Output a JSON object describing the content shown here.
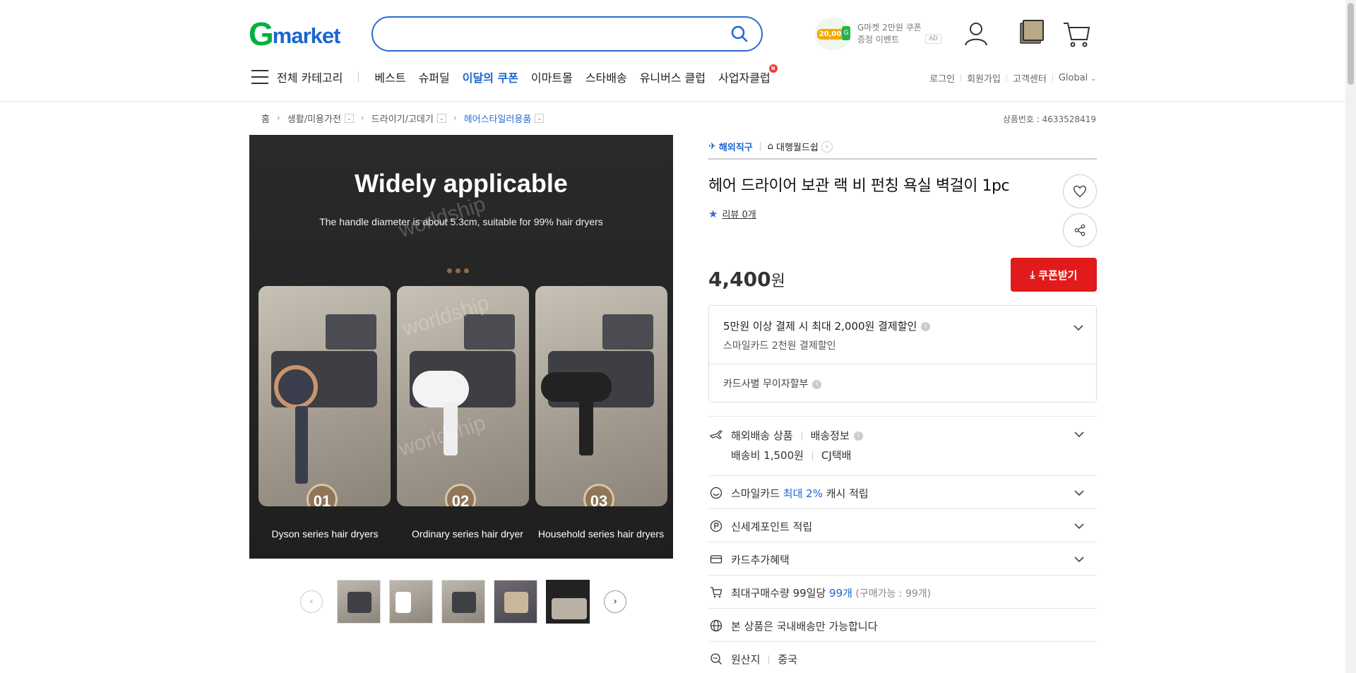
{
  "header": {
    "logo_g": "G",
    "logo_rest": "market",
    "search_placeholder": "",
    "ad": {
      "amount": "20,000",
      "g_mark": "G",
      "line1": "G마켓 2만원 쿠폰",
      "line2": "증정 이벤트",
      "tag": "AD"
    }
  },
  "gnb": {
    "all_category": "전체 카테고리",
    "items": [
      "베스트",
      "슈퍼딜",
      "이달의 쿠폰",
      "이마트몰",
      "스타배송",
      "유니버스 클럽",
      "사업자클럽"
    ],
    "new_badge": "N",
    "util": [
      "로그인",
      "회원가입",
      "고객센터",
      "Global"
    ]
  },
  "breadcrumb": {
    "items": [
      "홈",
      "생활/미용가전",
      "드라이기/고데기",
      "헤어스타일러용품"
    ],
    "product_no": "상품번호 : 4633528419"
  },
  "image": {
    "title": "Widely applicable",
    "subtitle": "The handle diameter is about 5.3cm, suitable for 99% hair dryers",
    "watermark": "worldship",
    "panels": [
      {
        "num": "01",
        "caption": "Dyson series hair dryers"
      },
      {
        "num": "02",
        "caption": "Ordinary series hair dryer"
      },
      {
        "num": "03",
        "caption": "Household series hair dryers"
      }
    ]
  },
  "product": {
    "overseas": "해외직구",
    "shop": "대행월드쉽",
    "title": "헤어 드라이어 보관 랙 비 펀칭 욕실 벽걸이 1pc",
    "review": "리뷰 0개",
    "price": "4,400",
    "won": "원",
    "coupon_button": "쿠폰받기",
    "discount": {
      "line1": "5만원 이상 결제 시 최대 2,000원 결제할인",
      "line2": "스마일카드 2천원 결제할인",
      "installment": "카드사별 무이자할부"
    },
    "shipping": {
      "type": "해외배송 상품",
      "info": "배송정보",
      "fee": "배송비 1,500원",
      "carrier": "CJ택배"
    },
    "smile_pre": "스마일카드 ",
    "smile_hl": "최대 2%",
    "smile_post": " 캐시 적립",
    "shinsegae": "신세계포인트 적립",
    "card_benefit": "카드추가혜택",
    "maxbuy_pre": "최대구매수량 99일당 ",
    "maxbuy_hl": "99개",
    "maxbuy_note": " (구매가능 : 99개)",
    "domestic": "본 상품은 국내배송만 가능합니다",
    "origin_label": "원산지",
    "origin_value": "중국"
  },
  "colors": {
    "brand_green": "#00b140",
    "brand_blue": "#1a66d1",
    "coupon_red": "#e11b1b"
  }
}
